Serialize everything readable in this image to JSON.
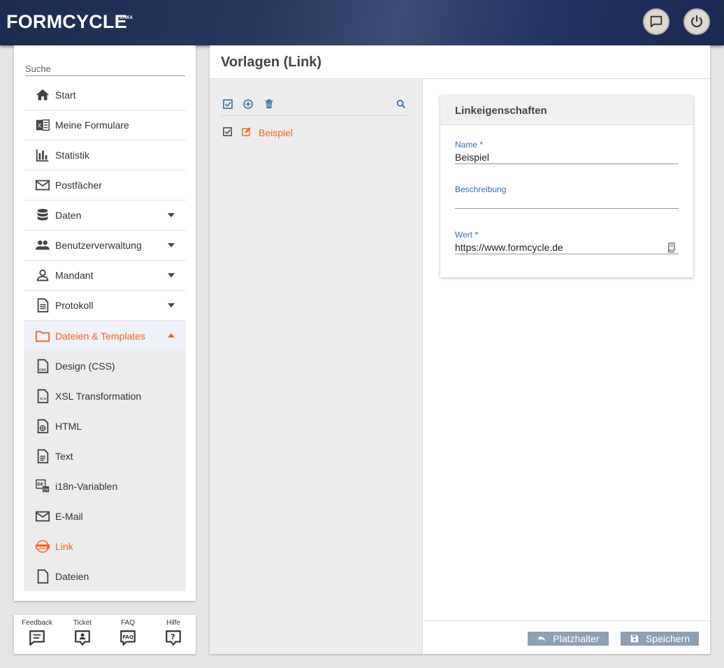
{
  "header": {
    "brand": "FORMCYCLE",
    "brand_sup": "XIMA",
    "chat_icon": "chat-icon",
    "power_icon": "power-icon"
  },
  "sidebar": {
    "search_placeholder": "Suche",
    "items": [
      {
        "label": "Start",
        "icon": "home-icon"
      },
      {
        "label": "Meine Formulare",
        "icon": "forms-icon"
      },
      {
        "label": "Statistik",
        "icon": "chart-icon"
      },
      {
        "label": "Postfächer",
        "icon": "mail-icon"
      },
      {
        "label": "Daten",
        "icon": "database-icon"
      },
      {
        "label": "Benutzerverwaltung",
        "icon": "users-icon"
      },
      {
        "label": "Mandant",
        "icon": "person-icon"
      },
      {
        "label": "Protokoll",
        "icon": "document-icon"
      },
      {
        "label": "Dateien & Templates",
        "icon": "folder-icon"
      }
    ],
    "subitems": [
      {
        "label": "Design (CSS)",
        "icon": "css-file-icon"
      },
      {
        "label": "XSL Transformation",
        "icon": "code-file-icon"
      },
      {
        "label": "HTML",
        "icon": "html-file-icon"
      },
      {
        "label": "Text",
        "icon": "text-file-icon"
      },
      {
        "label": "i18n-Variablen",
        "icon": "i18n-icon"
      },
      {
        "label": "E-Mail",
        "icon": "mail-icon"
      },
      {
        "label": "Link",
        "icon": "www-icon"
      },
      {
        "label": "Dateien",
        "icon": "file-icon"
      }
    ]
  },
  "help": {
    "feedback": "Feedback",
    "ticket": "Ticket",
    "faq": "FAQ",
    "hilfe": "Hilfe"
  },
  "main": {
    "title": "Vorlagen (Link)",
    "list": [
      {
        "label": "Beispiel"
      }
    ],
    "card": {
      "title": "Linkeigenschaften",
      "name_label": "Name *",
      "name_value": "Beispiel",
      "desc_label": "Beschreibung",
      "desc_value": "",
      "wert_label": "Wert *",
      "wert_value": "https://www.formcycle.de"
    },
    "buttons": {
      "platzhalter": "Platzhalter",
      "speichern": "Speichern"
    }
  },
  "colors": {
    "accent": "#f26522",
    "link_blue": "#3a6ea5",
    "button_bg": "#8da0b4"
  }
}
